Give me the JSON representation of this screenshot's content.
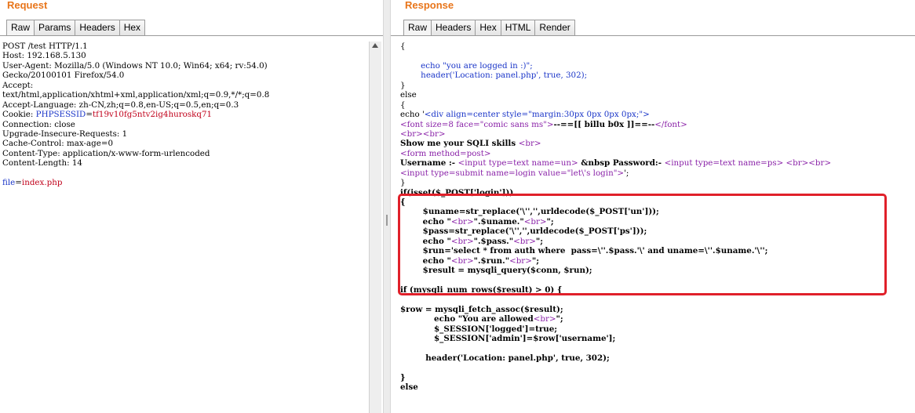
{
  "request": {
    "title": "Request",
    "tabs": [
      "Raw",
      "Params",
      "Headers",
      "Hex"
    ],
    "active_tab": "Raw",
    "lines": [
      [
        {
          "t": "POST /test HTTP/1.1",
          "c": ""
        }
      ],
      [
        {
          "t": "Host: 192.168.5.130",
          "c": ""
        }
      ],
      [
        {
          "t": "User-Agent: Mozilla/5.0 (Windows NT 10.0; Win64; x64; rv:54.0)",
          "c": ""
        }
      ],
      [
        {
          "t": "Gecko/20100101 Firefox/54.0",
          "c": ""
        }
      ],
      [
        {
          "t": "Accept:",
          "c": ""
        }
      ],
      [
        {
          "t": "text/html,application/xhtml+xml,application/xml;q=0.9,*/*;q=0.8",
          "c": ""
        }
      ],
      [
        {
          "t": "Accept-Language: zh-CN,zh;q=0.8,en-US;q=0.5,en;q=0.3",
          "c": ""
        }
      ],
      [
        {
          "t": "Cookie: ",
          "c": ""
        },
        {
          "t": "PHPSESSID",
          "c": "blue"
        },
        {
          "t": "=",
          "c": ""
        },
        {
          "t": "tf19v10fg5ntv2ig4huroskq71",
          "c": "red"
        }
      ],
      [
        {
          "t": "Connection: close",
          "c": ""
        }
      ],
      [
        {
          "t": "Upgrade-Insecure-Requests: 1",
          "c": ""
        }
      ],
      [
        {
          "t": "Cache-Control: max-age=0",
          "c": ""
        }
      ],
      [
        {
          "t": "Content-Type: application/x-www-form-urlencoded",
          "c": ""
        }
      ],
      [
        {
          "t": "Content-Length: 14",
          "c": ""
        }
      ],
      [
        {
          "t": "",
          "c": ""
        }
      ],
      [
        {
          "t": "file",
          "c": "blue"
        },
        {
          "t": "=",
          "c": ""
        },
        {
          "t": "index.php",
          "c": "red"
        }
      ]
    ]
  },
  "response": {
    "title": "Response",
    "tabs": [
      "Raw",
      "Headers",
      "Hex",
      "HTML",
      "Render"
    ],
    "active_tab": "Raw",
    "lines": [
      [
        {
          "t": "{",
          "c": ""
        }
      ],
      [
        {
          "t": "",
          "c": ""
        }
      ],
      [
        {
          "t": "        echo \"you are logged in :)\";",
          "c": "str"
        }
      ],
      [
        {
          "t": "        header('Location: panel.php', true, 302);",
          "c": "str"
        }
      ],
      [
        {
          "t": "}",
          "c": ""
        }
      ],
      [
        {
          "t": "else",
          "c": ""
        }
      ],
      [
        {
          "t": "{",
          "c": ""
        }
      ],
      [
        {
          "t": "echo '",
          "c": ""
        },
        {
          "t": "<div align=center style=\"margin:30px 0px 0px 0px;\">",
          "c": "str"
        }
      ],
      [
        {
          "t": "<font size=8 face=\"comic sans ms\">",
          "c": "purple"
        },
        {
          "t": "--==[[ billu b0x ]]==--",
          "c": "b"
        },
        {
          "t": "</font>",
          "c": "purple"
        }
      ],
      [
        {
          "t": "<br><br>",
          "c": "purple"
        }
      ],
      [
        {
          "t": "Show me your SQLI skills ",
          "c": "b"
        },
        {
          "t": "<br>",
          "c": "purple"
        }
      ],
      [
        {
          "t": "<form method=post>",
          "c": "purple"
        }
      ],
      [
        {
          "t": "Username :- ",
          "c": "b"
        },
        {
          "t": "<input type=text name=un>",
          "c": "purple"
        },
        {
          "t": " &nbsp Password:- ",
          "c": "b"
        },
        {
          "t": "<input type=text name=ps>",
          "c": "purple"
        },
        {
          "t": " ",
          "c": ""
        },
        {
          "t": "<br><br>",
          "c": "purple"
        }
      ],
      [
        {
          "t": "<input type=submit name=login value=\"let\\'s login\">",
          "c": "purple"
        },
        {
          "t": "';",
          "c": ""
        }
      ],
      [
        {
          "t": "}",
          "c": ""
        }
      ],
      [
        {
          "t": "if(isset($_POST['login']))",
          "c": "b"
        }
      ],
      [
        {
          "t": "{",
          "c": "b"
        }
      ],
      [
        {
          "t": "        $uname=str_replace('\\'','',urldecode($_POST['un']));",
          "c": "b"
        }
      ],
      [
        {
          "t": "        echo \"",
          "c": "b"
        },
        {
          "t": "<br>",
          "c": "purple"
        },
        {
          "t": "\".$uname.\"",
          "c": "b"
        },
        {
          "t": "<br>",
          "c": "purple"
        },
        {
          "t": "\";",
          "c": "b"
        }
      ],
      [
        {
          "t": "        $pass=str_replace('\\'','',urldecode($_POST['ps']));",
          "c": "b"
        }
      ],
      [
        {
          "t": "        echo \"",
          "c": "b"
        },
        {
          "t": "<br>",
          "c": "purple"
        },
        {
          "t": "\".$pass.\"",
          "c": "b"
        },
        {
          "t": "<br>",
          "c": "purple"
        },
        {
          "t": "\";",
          "c": "b"
        }
      ],
      [
        {
          "t": "        $run='select * from auth where  pass=\\''.$pass.'\\' and uname=\\''.$uname.'\\'';",
          "c": "b"
        }
      ],
      [
        {
          "t": "        echo \"",
          "c": "b"
        },
        {
          "t": "<br>",
          "c": "purple"
        },
        {
          "t": "\".$run.\"",
          "c": "b"
        },
        {
          "t": "<br>",
          "c": "purple"
        },
        {
          "t": "\";",
          "c": "b"
        }
      ],
      [
        {
          "t": "        $result = mysqli_query($conn, $run);",
          "c": "b"
        }
      ],
      [
        {
          "t": "",
          "c": ""
        }
      ],
      [
        {
          "t": "if (mysqli_num_rows($result) > 0) {",
          "c": "b"
        }
      ],
      [
        {
          "t": "",
          "c": ""
        }
      ],
      [
        {
          "t": "$row = mysqli_fetch_assoc($result);",
          "c": "b"
        }
      ],
      [
        {
          "t": "            echo \"You are allowed",
          "c": "b"
        },
        {
          "t": "<br>",
          "c": "purple"
        },
        {
          "t": "\";",
          "c": "b"
        }
      ],
      [
        {
          "t": "            $_SESSION['logged']=true;",
          "c": "b"
        }
      ],
      [
        {
          "t": "            $_SESSION['admin']=$row['username'];",
          "c": "b"
        }
      ],
      [
        {
          "t": "",
          "c": ""
        }
      ],
      [
        {
          "t": "         header('Location: panel.php', true, 302);",
          "c": "b"
        }
      ],
      [
        {
          "t": "",
          "c": ""
        }
      ],
      [
        {
          "t": "}",
          "c": "b"
        }
      ],
      [
        {
          "t": "else",
          "c": "b"
        }
      ]
    ]
  }
}
